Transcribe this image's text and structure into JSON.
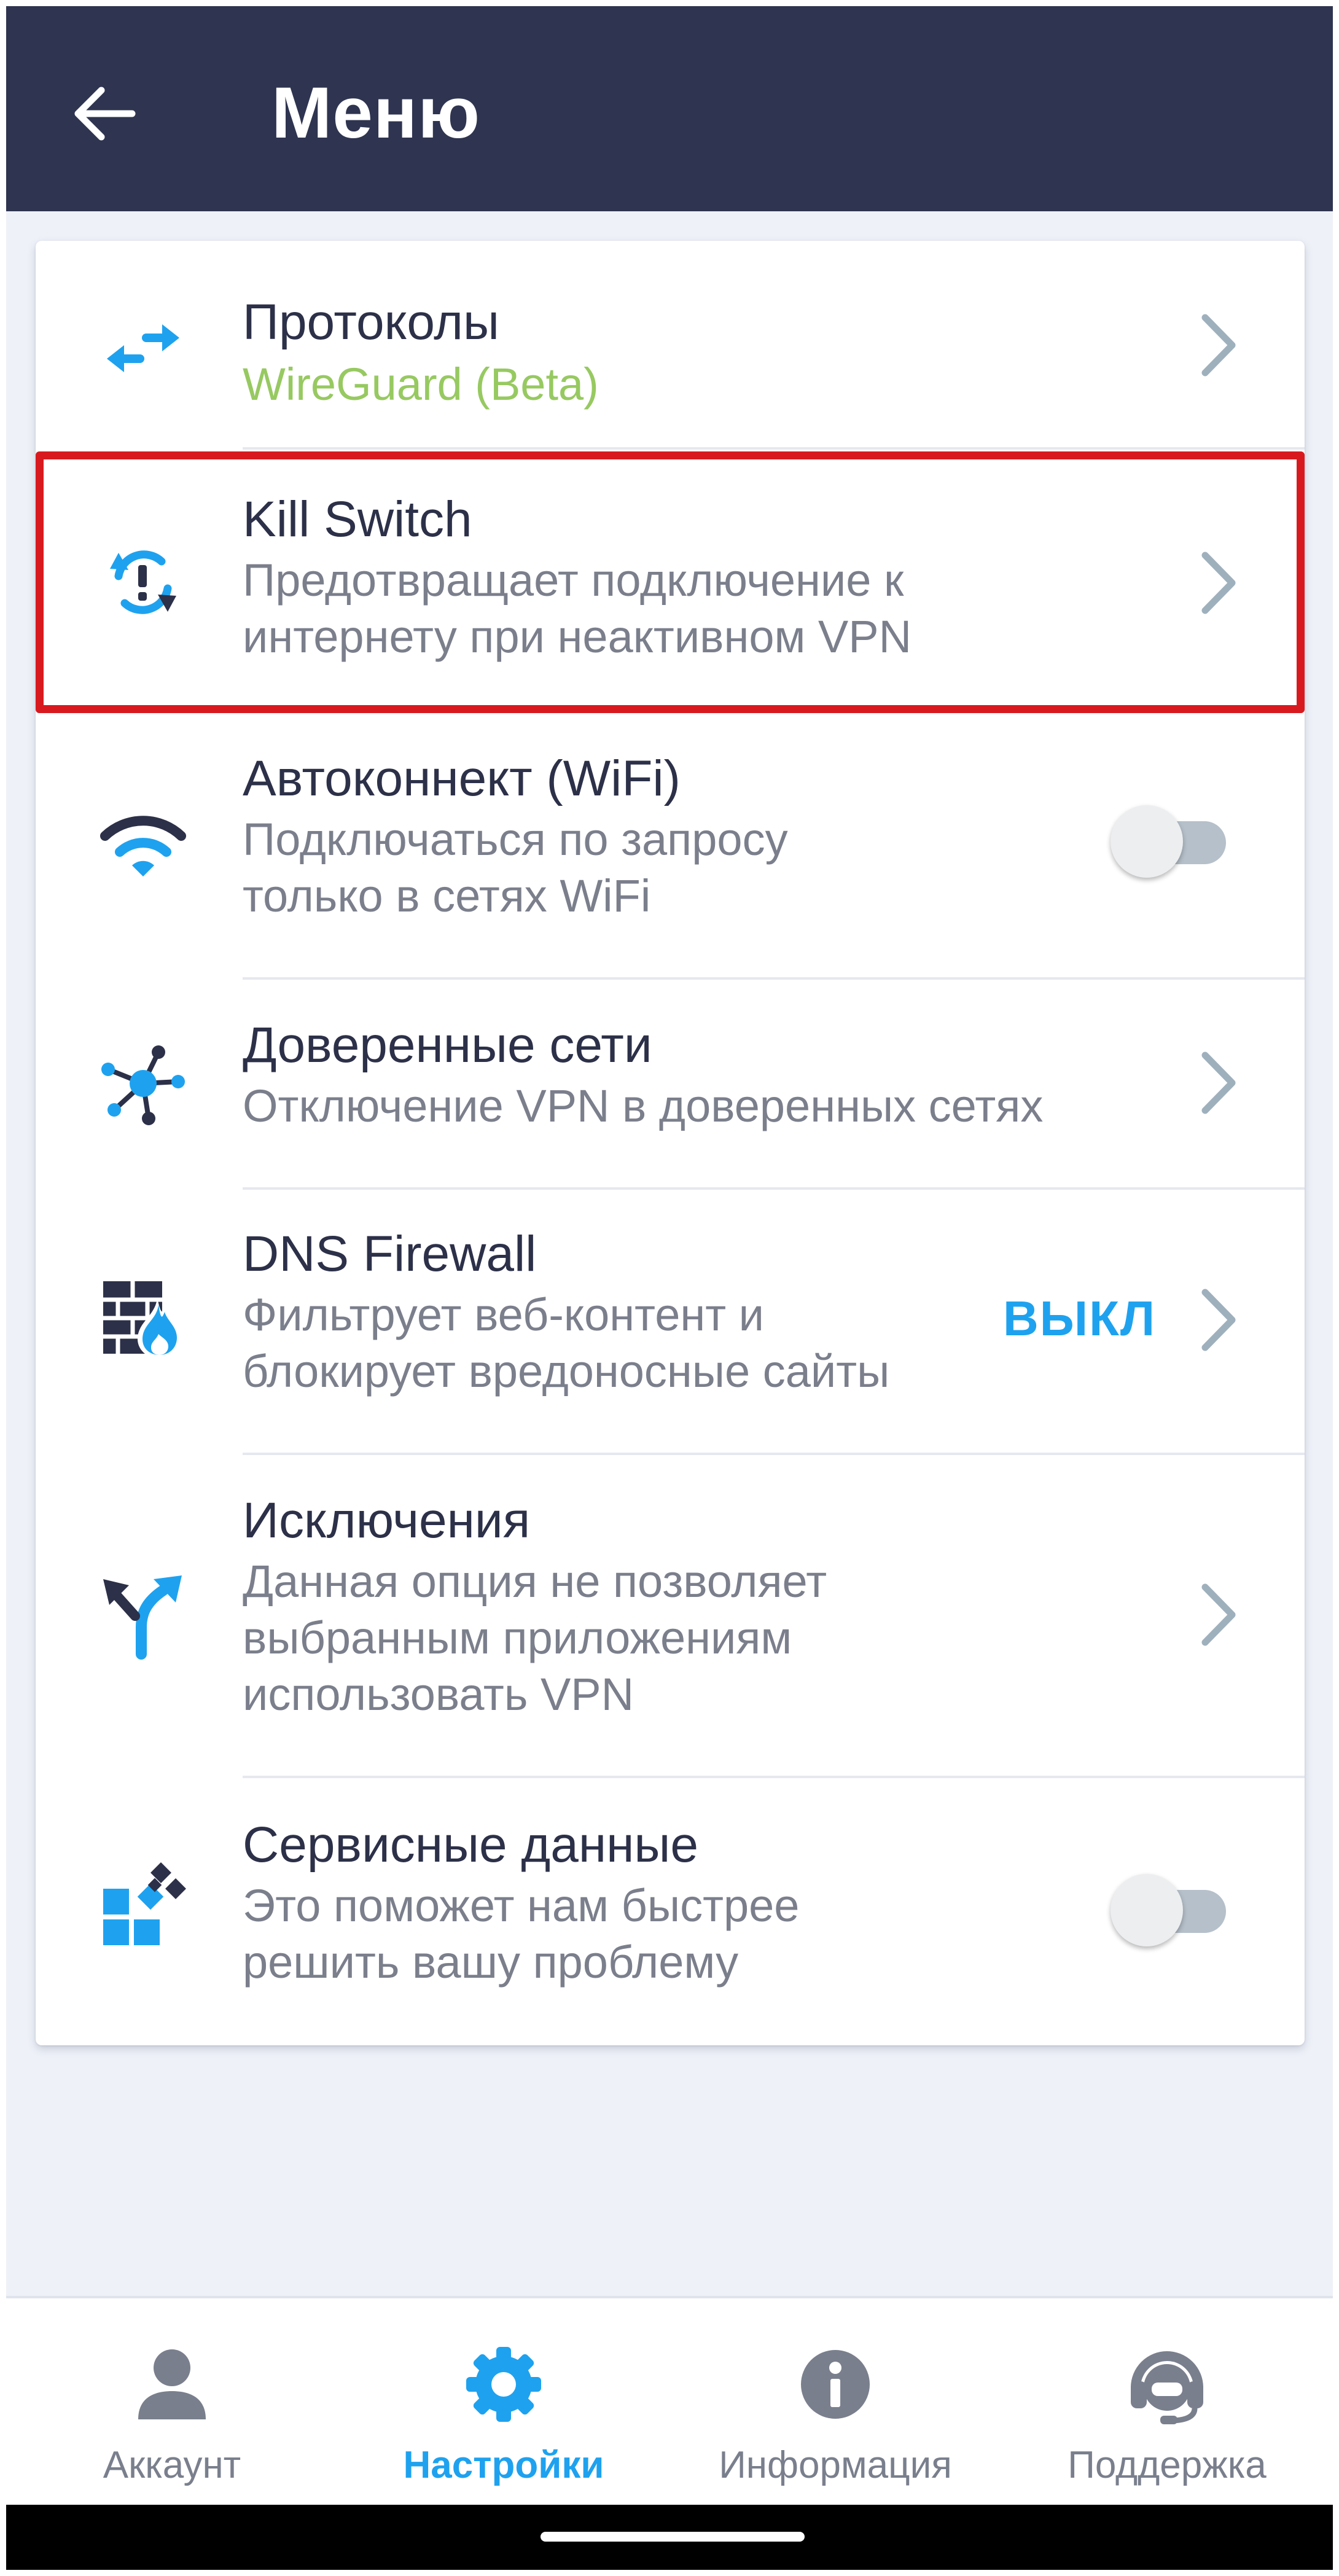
{
  "header": {
    "title": "Меню"
  },
  "menu": {
    "protocols": {
      "title": "Протоколы",
      "subtitle": "WireGuard (Beta)"
    },
    "kill_switch": {
      "title": "Kill Switch",
      "subtitle_line1": "Предотвращает подключение к",
      "subtitle_line2": "интернету при неактивном VPN"
    },
    "autoconnect": {
      "title": "Автоконнект (WiFi)",
      "subtitle_line1": "Подключаться по запросу",
      "subtitle_line2": "только в сетях WiFi",
      "enabled": false
    },
    "trusted_networks": {
      "title": "Доверенные сети",
      "subtitle": "Отключение VPN в доверенных сетях"
    },
    "dns_firewall": {
      "title": "DNS Firewall",
      "subtitle_line1": "Фильтрует веб-контент и",
      "subtitle_line2": "блокирует вредоносные сайты",
      "status": "ВЫКЛ"
    },
    "exclusions": {
      "title": "Исключения",
      "subtitle_line1": "Данная опция не позволяет",
      "subtitle_line2": "выбранным приложениям",
      "subtitle_line3": "использовать VPN"
    },
    "service_data": {
      "title": "Сервисные данные",
      "subtitle_line1": "Это поможет нам быстрее",
      "subtitle_line2": "решить вашу проблему",
      "enabled": false
    }
  },
  "bottom_nav": {
    "account": "Аккаунт",
    "settings": "Настройки",
    "info": "Информация",
    "support": "Поддержка",
    "active": "settings"
  },
  "colors": {
    "header_bg": "#2f3450",
    "accent": "#1ea2ef",
    "green": "#97c961",
    "highlight": "#d81a1f"
  },
  "icons": {
    "back": "arrow-left-icon",
    "protocols": "swap-arrows-icon",
    "kill_switch": "sync-alert-icon",
    "autoconnect": "wifi-icon",
    "trusted_networks": "network-hub-icon",
    "dns_firewall": "firewall-icon",
    "exclusions": "split-arrows-icon",
    "service_data": "widgets-icon"
  }
}
